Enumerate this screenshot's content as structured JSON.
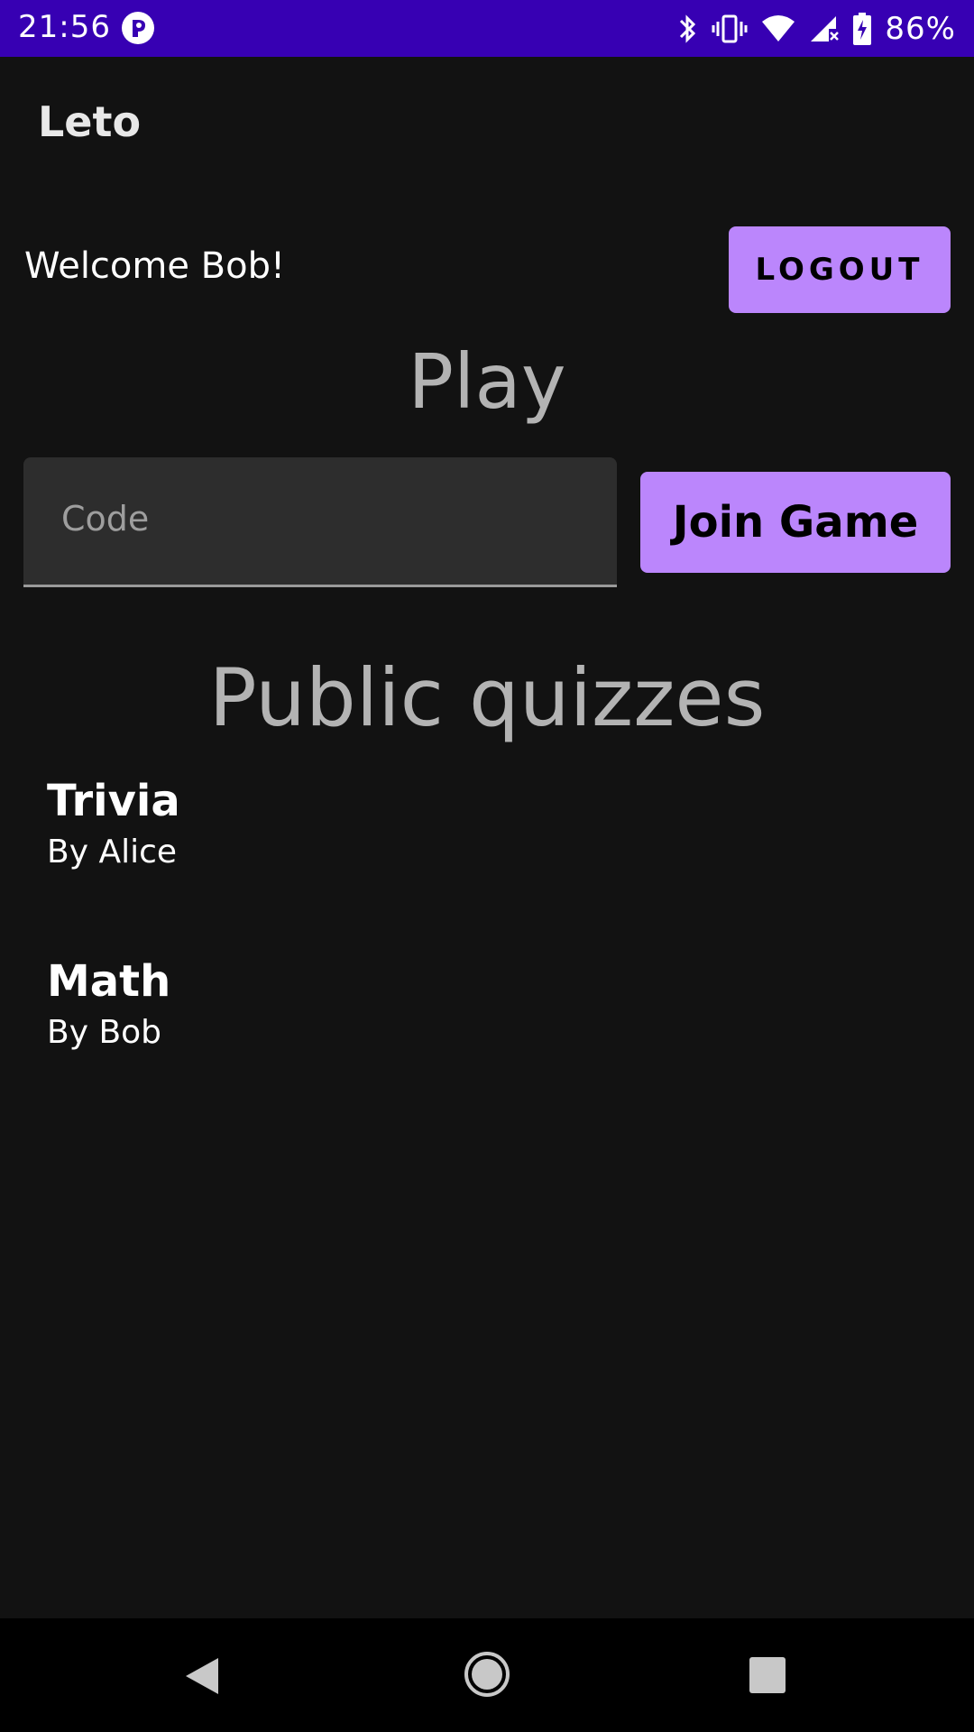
{
  "status_bar": {
    "time": "21:56",
    "battery_percent": "86%",
    "icons": [
      "app-notification-icon",
      "bluetooth-icon",
      "vibrate-icon",
      "wifi-icon",
      "cell-signal-icon",
      "battery-charging-icon"
    ],
    "background_color": "#3700b3"
  },
  "app_bar": {
    "title": "Leto"
  },
  "header": {
    "welcome": "Welcome Bob!",
    "logout_label": "LOGOUT"
  },
  "play": {
    "heading": "Play",
    "code_placeholder": "Code",
    "code_value": "",
    "join_label": "Join Game"
  },
  "public_quizzes": {
    "heading": "Public quizzes",
    "items": [
      {
        "title": "Trivia",
        "author": "By Alice"
      },
      {
        "title": "Math",
        "author": "By Bob"
      }
    ]
  },
  "nav_bar": {
    "icons": [
      "back-icon",
      "home-icon",
      "recents-icon"
    ]
  },
  "colors": {
    "accent": "#bb86fc",
    "background": "#121212",
    "status_bar": "#3700b3"
  }
}
